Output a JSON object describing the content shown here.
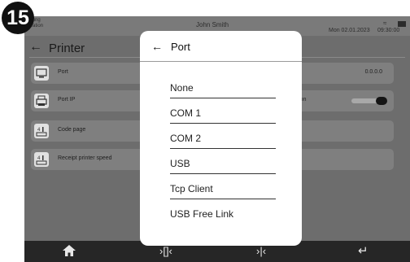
{
  "step_number": "15",
  "status_bar": {
    "left_text": "…ting\n…ation",
    "user": "John Smith",
    "date": "Mon 02.01.2023",
    "time": "09:30:00",
    "wifi_icon": "wifi-icon",
    "battery_icon": "battery-icon"
  },
  "page": {
    "title": "Printer",
    "back_icon": "arrow-left-icon"
  },
  "rows": [
    {
      "label": "Port",
      "value": "0.0.0.0",
      "icon": "monitor-icon"
    },
    {
      "label": "Port IP",
      "suffix": "…nnection",
      "toggle_on": true,
      "icon": "printer-icon"
    },
    {
      "label": "Code page",
      "icon": "keypad-icon"
    },
    {
      "label": "Receipt printer speed",
      "icon": "keypad-icon"
    }
  ],
  "modal": {
    "title": "Port",
    "back_icon": "arrow-left-icon",
    "options": [
      "None",
      "COM 1",
      "COM 2",
      "USB",
      "Tcp Client",
      "USB Free Link"
    ]
  },
  "bottom_bar": {
    "home_icon": "home-icon",
    "barcode_in_icon": "barcode-scan-in-icon",
    "barcode_out_icon": "barcode-scan-out-icon",
    "enter_icon": "enter-icon",
    "barcode_in_text": "›[]‹",
    "barcode_out_text": "›|‹",
    "enter_text": "↵"
  },
  "colors": {
    "dim_background": "#6d6d6d",
    "row_background": "#7f7f7f",
    "modal_background": "#ffffff",
    "bottom_bar": "#262626",
    "badge": "#111111"
  }
}
